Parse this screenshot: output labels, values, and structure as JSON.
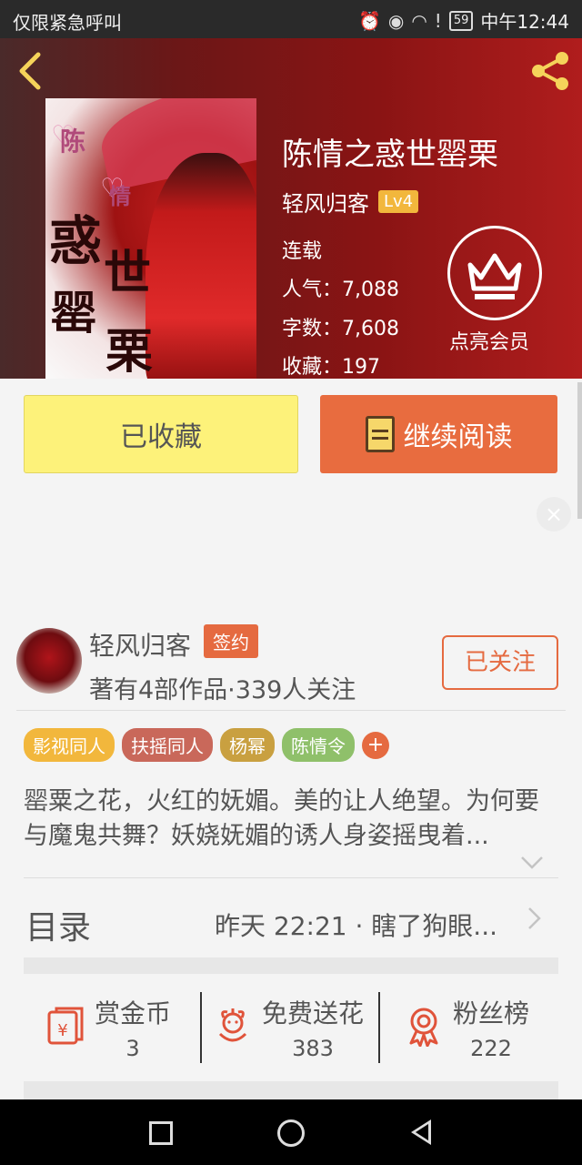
{
  "status_bar": {
    "carrier": "仅限紧急呼叫",
    "battery": "59",
    "time": "中午12:44"
  },
  "book": {
    "title": "陈情之惑世罂栗",
    "author": "轻风归客",
    "level": "Lv4",
    "status": "连载",
    "popularity": "人气：7,088",
    "word_count": "字数：7,608",
    "favorites": "收藏：197",
    "vip_label": "点亮会员",
    "cover_text": {
      "c1": "惑",
      "c2": "世",
      "c3": "罂",
      "c4": "栗",
      "c5": "陈",
      "c6": "情"
    }
  },
  "actions": {
    "favorited": "已收藏",
    "continue_reading": "继续阅读",
    "close": "×"
  },
  "author_card": {
    "name": "轻风归客",
    "badge": "签约",
    "stats": "著有4部作品·339人关注",
    "follow": "已关注"
  },
  "tags": [
    {
      "label": "影视同人",
      "color": "#f2b73c"
    },
    {
      "label": "扶摇同人",
      "color": "#c9685a"
    },
    {
      "label": "杨幂",
      "color": "#c9a040"
    },
    {
      "label": "陈情令",
      "color": "#8fc06a"
    }
  ],
  "tag_add": "+",
  "description": "罂粟之花，火红的妩媚。美的让人绝望。为何要与魔鬼共舞？妖娆妩媚的诱人身姿摇曳着...",
  "catalog": {
    "label": "目录",
    "latest": "昨天 22:21 · 瞎了狗眼..."
  },
  "stats": [
    {
      "label": "赏金币",
      "value": "3",
      "icon": "red-envelope-icon"
    },
    {
      "label": "免费送花",
      "value": "383",
      "icon": "flower-icon"
    },
    {
      "label": "粉丝榜",
      "value": "222",
      "icon": "award-icon"
    }
  ],
  "colors": {
    "accent": "#e56a40",
    "fav_button": "#fdf27a",
    "header": "#8a1414"
  }
}
